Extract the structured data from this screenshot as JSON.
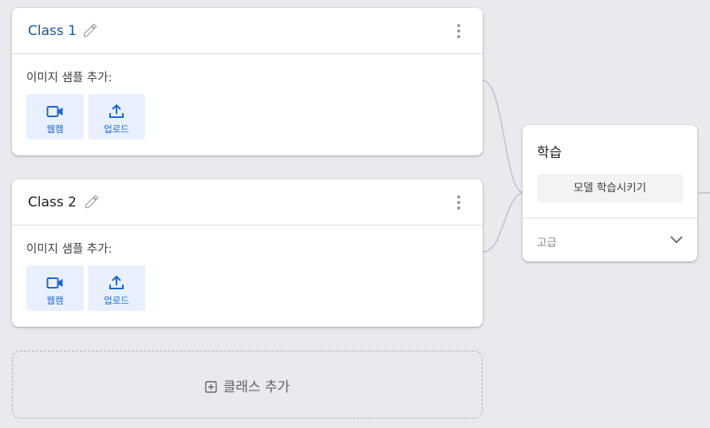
{
  "classes": [
    {
      "title": "Class 1",
      "add_samples_label": "이미지 샘플 추가:",
      "webcam_label": "웹캠",
      "upload_label": "업로드"
    },
    {
      "title": "Class 2",
      "add_samples_label": "이미지 샘플 추가:",
      "webcam_label": "웹캠",
      "upload_label": "업로드"
    }
  ],
  "add_class_label": "클래스 추가",
  "training": {
    "title": "학습",
    "train_button": "모델 학습시키기",
    "advanced_label": "고급"
  },
  "colors": {
    "accent_blue": "#1967d2",
    "button_bg": "#e8f0fe",
    "page_bg": "#e8eaed"
  },
  "icons": [
    "pencil-icon",
    "more-vert-icon",
    "webcam-icon",
    "upload-icon",
    "add-box-icon",
    "chevron-down-icon"
  ]
}
